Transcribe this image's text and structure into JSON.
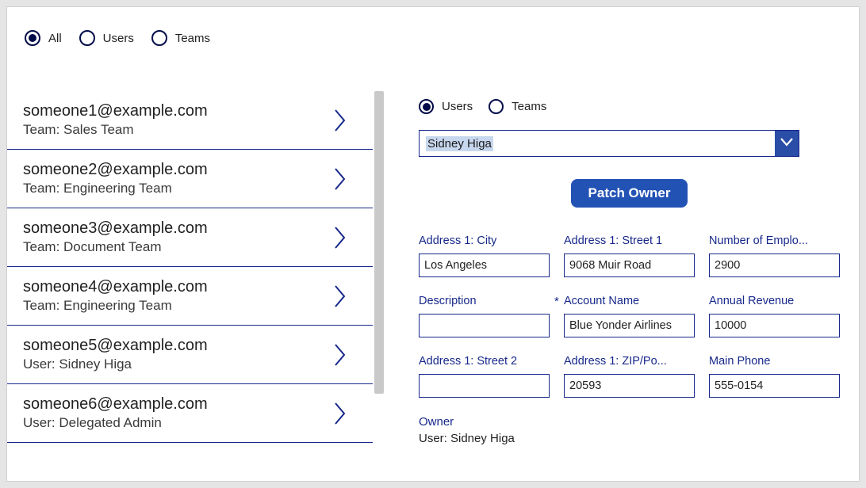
{
  "filters": {
    "all": {
      "label": "All",
      "selected": true
    },
    "users": {
      "label": "Users",
      "selected": false
    },
    "teams": {
      "label": "Teams",
      "selected": false
    }
  },
  "list": [
    {
      "primary": "someone1@example.com",
      "secondary": "Team: Sales Team"
    },
    {
      "primary": "someone2@example.com",
      "secondary": "Team: Engineering Team"
    },
    {
      "primary": "someone3@example.com",
      "secondary": "Team: Document Team"
    },
    {
      "primary": "someone4@example.com",
      "secondary": "Team: Engineering Team"
    },
    {
      "primary": "someone5@example.com",
      "secondary": "User: Sidney Higa"
    },
    {
      "primary": "someone6@example.com",
      "secondary": "User: Delegated Admin"
    }
  ],
  "detail": {
    "scope": {
      "users": {
        "label": "Users",
        "selected": true
      },
      "teams": {
        "label": "Teams",
        "selected": false
      }
    },
    "selector": {
      "value": "Sidney Higa"
    },
    "patchButton": "Patch Owner",
    "fields": {
      "city": {
        "label": "Address 1: City",
        "value": "Los Angeles",
        "required": false
      },
      "street1": {
        "label": "Address 1: Street 1",
        "value": "9068 Muir Road",
        "required": false
      },
      "employees": {
        "label": "Number of Emplo...",
        "value": "2900",
        "required": false
      },
      "description": {
        "label": "Description",
        "value": "",
        "required": false
      },
      "accountName": {
        "label": "Account Name",
        "value": "Blue Yonder Airlines",
        "required": true
      },
      "revenue": {
        "label": "Annual Revenue",
        "value": "10000",
        "required": false
      },
      "street2": {
        "label": "Address 1: Street 2",
        "value": "",
        "required": false
      },
      "zip": {
        "label": "Address 1: ZIP/Po...",
        "value": "20593",
        "required": false
      },
      "phone": {
        "label": "Main Phone",
        "value": "555-0154",
        "required": false
      }
    },
    "owner": {
      "label": "Owner",
      "value": "User: Sidney Higa"
    }
  }
}
